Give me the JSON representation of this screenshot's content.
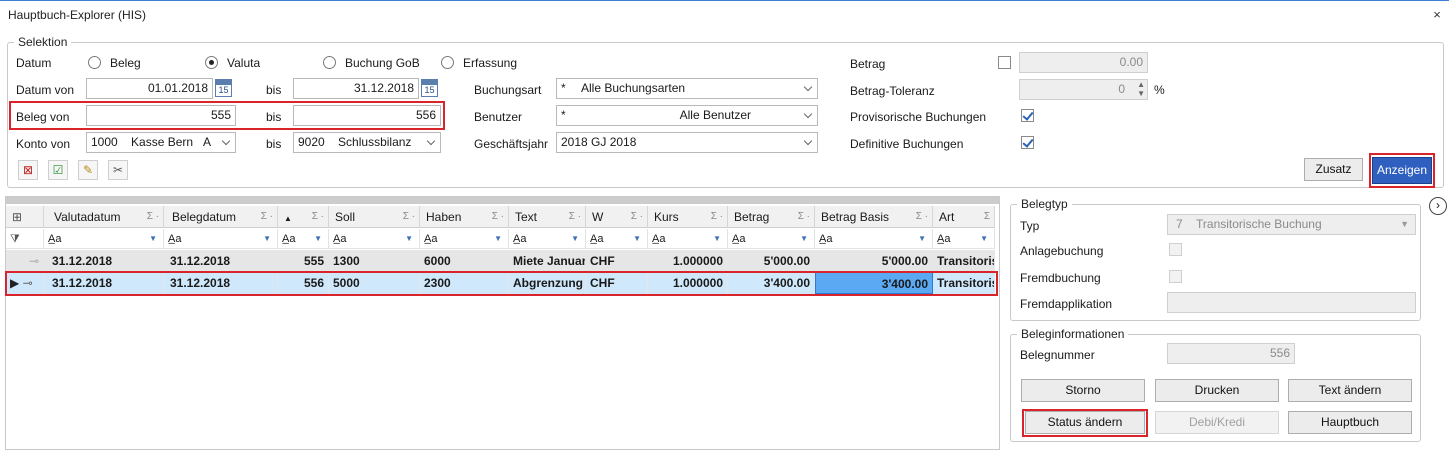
{
  "window": {
    "title": "Hauptbuch-Explorer (HIS)",
    "close": "×"
  },
  "selektion": {
    "group_label": "Selektion",
    "datum_label": "Datum",
    "radio_beleg": "Beleg",
    "radio_valuta": "Valuta",
    "radio_buchung_gob": "Buchung GoB",
    "radio_erfassung": "Erfassung",
    "datum_von_label": "Datum von",
    "datum_von": "01.01.2018",
    "bis": "bis",
    "datum_bis": "31.12.2018",
    "cal_day": "15",
    "beleg_von_label": "Beleg von",
    "beleg_von": "555",
    "beleg_bis": "556",
    "konto_von_label": "Konto von",
    "konto_von_nr": "1000",
    "konto_von_name": "Kasse Bern",
    "konto_von_suffix": "A",
    "konto_bis_nr": "9020",
    "konto_bis_name": "Schlussbilanz",
    "buchungsart_label": "Buchungsart",
    "buchungsart_code": "*",
    "buchungsart_value": "Alle Buchungsarten",
    "benutzer_label": "Benutzer",
    "benutzer_code": "*",
    "benutzer_value": "Alle Benutzer",
    "geschaeftsjahr_label": "Geschäftsjahr",
    "geschaeftsjahr_value": "2018  GJ 2018",
    "betrag_label": "Betrag",
    "betrag_value": "0.00",
    "betrag_toleranz_label": "Betrag-Toleranz",
    "betrag_toleranz_value": "0",
    "percent": "%",
    "provisorische_label": "Provisorische Buchungen",
    "definitive_label": "Definitive Buchungen",
    "zusatz_button": "Zusatz",
    "anzeigen_button": "Anzeigen"
  },
  "grid": {
    "columns": [
      "Valutadatum",
      "Belegdatum",
      "",
      "Soll",
      "Haben",
      "Text",
      "W",
      "Kurs",
      "Betrag",
      "Betrag Basis",
      "Art"
    ],
    "filter_glyph": "A̲a",
    "sum_glyph": "Σ ·",
    "rows": [
      {
        "valutadatum": "31.12.2018",
        "belegdatum": "31.12.2018",
        "beleg": "555",
        "soll": "1300",
        "haben": "6000",
        "text": "Miete Januar",
        "w": "CHF",
        "kurs": "1.000000",
        "betrag": "5'000.00",
        "betrag_basis": "5'000.00",
        "art": "Transitoris"
      },
      {
        "valutadatum": "31.12.2018",
        "belegdatum": "31.12.2018",
        "beleg": "556",
        "soll": "5000",
        "haben": "2300",
        "text": "Abgrenzung F",
        "w": "CHF",
        "kurs": "1.000000",
        "betrag": "3'400.00",
        "betrag_basis": "3'400.00",
        "art": "Transitoris"
      }
    ]
  },
  "belegtyp": {
    "group_label": "Belegtyp",
    "typ_label": "Typ",
    "typ_code": "7",
    "typ_value": "Transitorische Buchung",
    "anlage_label": "Anlagebuchung",
    "fremd_label": "Fremdbuchung",
    "fremdapp_label": "Fremdapplikation",
    "fremdapp_value": ""
  },
  "beleginfo": {
    "group_label": "Beleginformationen",
    "belegnummer_label": "Belegnummer",
    "belegnummer_value": "556",
    "storno": "Storno",
    "drucken": "Drucken",
    "text_aendern": "Text ändern",
    "status_aendern": "Status ändern",
    "debi_kredi": "Debi/Kredi",
    "hauptbuch": "Hauptbuch"
  },
  "colors": {
    "accent": "#2f5fbf",
    "highlight": "#d8242a",
    "selected_row": "#cfe8fb",
    "active_cell": "#5aa9f2"
  },
  "icons": [
    "clear-filter-icon",
    "select-all-icon",
    "edit-icon",
    "tools-icon",
    "chevron-right-icon",
    "calendar-icon",
    "column-chooser-icon",
    "filter-icon",
    "pin-icon",
    "row-indicator-icon"
  ]
}
